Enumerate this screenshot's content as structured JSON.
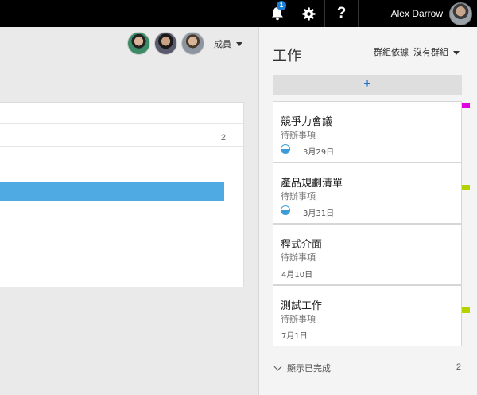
{
  "topbar": {
    "notification_count": "1",
    "help_label": "?",
    "user_name": "Alex Darrow"
  },
  "main": {
    "members_label": "成員",
    "count": "2",
    "progress_fraction": 0.92
  },
  "panel": {
    "title": "工作",
    "groupby_label": "群組依據",
    "groupby_value": "沒有群組",
    "add_label": "+",
    "tasks": [
      {
        "title": "競爭力會議",
        "status": "待辦事項",
        "date": "3月29日",
        "progress": "half",
        "flag_color": "#e000e0"
      },
      {
        "title": "產品規劃清單",
        "status": "待辦事項",
        "date": "3月31日",
        "progress": "half",
        "flag_color": "#b5d100"
      },
      {
        "title": "程式介面",
        "status": "待辦事項",
        "date": "4月10日",
        "progress": "none",
        "flag_color": ""
      },
      {
        "title": "測試工作",
        "status": "待辦事項",
        "date": "7月1日",
        "progress": "none",
        "flag_color": "#b5d100"
      }
    ],
    "show_completed_label": "顯示已完成",
    "completed_count": "2"
  },
  "icons": {
    "bell": "bell-icon",
    "gear": "gear-icon",
    "help": "help-icon",
    "chevron": "chevron-down-icon"
  },
  "colors": {
    "accent": "#1a6fc9",
    "progress": "#4fa9e3",
    "topbar": "#000000"
  }
}
